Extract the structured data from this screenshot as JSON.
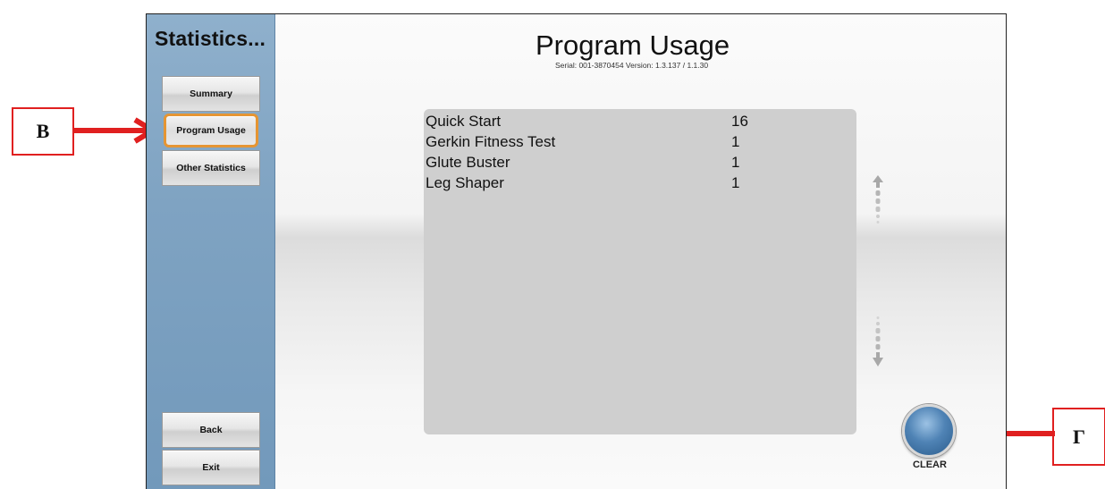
{
  "sidebar": {
    "title": "Statistics...",
    "buttons": [
      {
        "label": "Summary"
      },
      {
        "label": "Program Usage"
      },
      {
        "label": "Other Statistics"
      }
    ],
    "back_label": "Back",
    "exit_label": "Exit"
  },
  "header": {
    "title": "Program Usage",
    "subtitle": "Serial: 001-3870454   Version: 1.3.137 / 1.1.30"
  },
  "programs": [
    {
      "name": "Quick Start",
      "count": "16"
    },
    {
      "name": "Gerkin Fitness Test",
      "count": "1"
    },
    {
      "name": "Glute Buster",
      "count": "1"
    },
    {
      "name": "Leg Shaper",
      "count": "1"
    }
  ],
  "clear_label": "CLEAR",
  "callouts": {
    "left": "B",
    "right": "Г"
  },
  "colors": {
    "sidebar": "#7fa3c2",
    "selected_outline": "#e59533",
    "panel": "#cfcfcf",
    "callout_red": "#e02020"
  },
  "icons": {
    "scroll_up": "up-arrow-icon",
    "scroll_down": "down-arrow-icon",
    "callout_arrow": "red-arrow-icon"
  }
}
